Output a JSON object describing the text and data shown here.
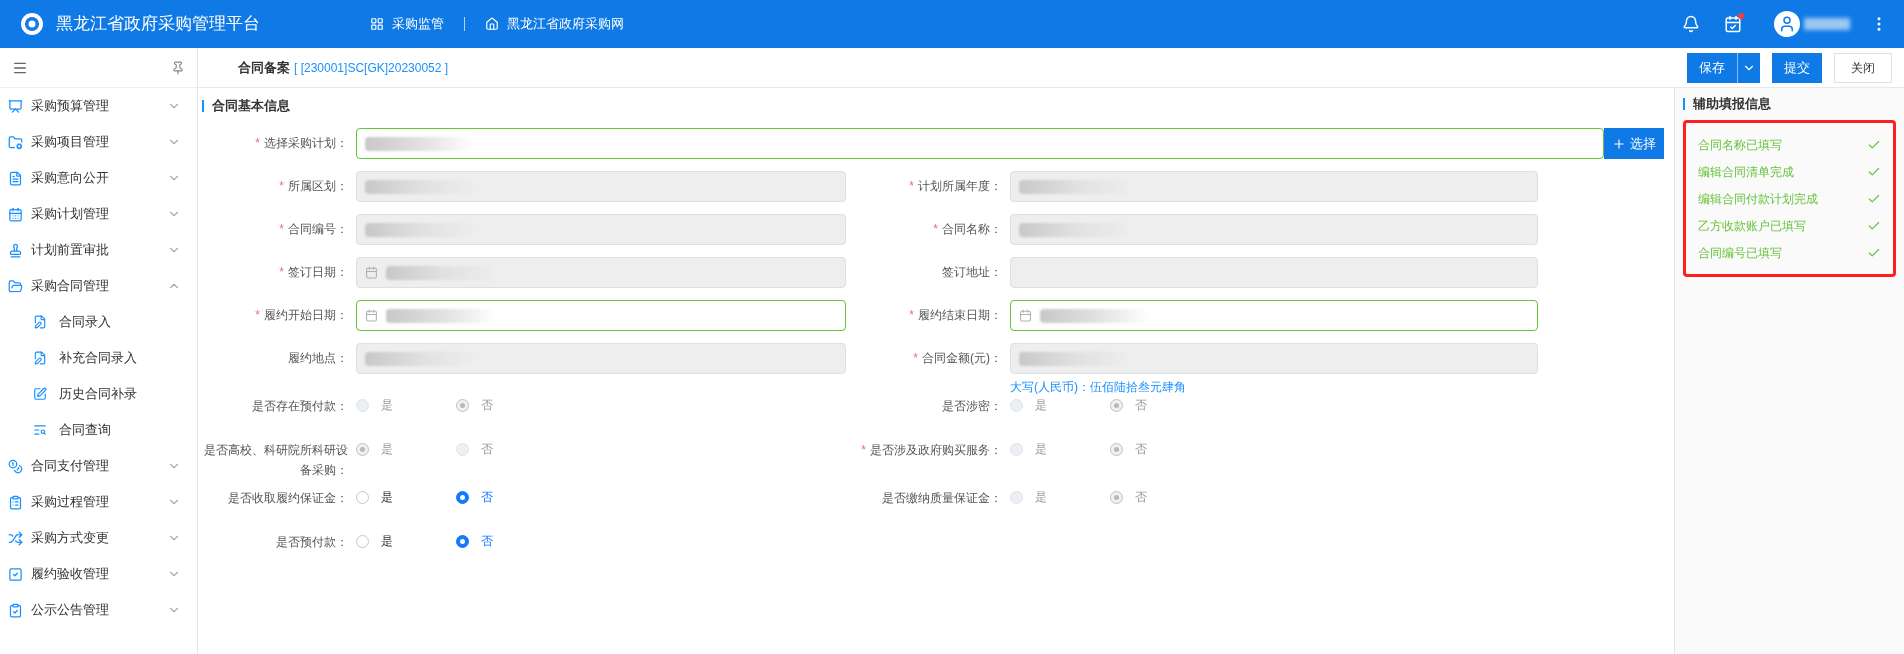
{
  "header": {
    "title": "黑龙江省政府采购管理平台",
    "nav": [
      "采购监管",
      "黑龙江省政府采购网"
    ],
    "notice_unread": true
  },
  "sidebar": {
    "items": [
      {
        "label": "采购预算管理",
        "expanded": false
      },
      {
        "label": "采购项目管理",
        "expanded": false
      },
      {
        "label": "采购意向公开",
        "expanded": false
      },
      {
        "label": "采购计划管理",
        "expanded": false
      },
      {
        "label": "计划前置审批",
        "expanded": false
      },
      {
        "label": "采购合同管理",
        "expanded": true,
        "children": [
          {
            "label": "合同录入"
          },
          {
            "label": "补充合同录入"
          },
          {
            "label": "历史合同补录"
          },
          {
            "label": "合同查询"
          }
        ]
      },
      {
        "label": "合同支付管理",
        "expanded": false
      },
      {
        "label": "采购过程管理",
        "expanded": false
      },
      {
        "label": "采购方式变更",
        "expanded": false
      },
      {
        "label": "履约验收管理",
        "expanded": false
      },
      {
        "label": "公示公告管理",
        "expanded": false
      }
    ]
  },
  "tab": {
    "title": "合同备案",
    "code": "[ [230001]SC[GK]20230052 ]"
  },
  "actions": [
    {
      "label": "保存",
      "kind": "split"
    },
    {
      "label": "提交",
      "kind": "primary"
    },
    {
      "label": "关闭",
      "kind": "plain"
    }
  ],
  "section": {
    "title": "合同基本信息"
  },
  "form": {
    "rows": [
      [
        {
          "kind": "select",
          "label": "选择采购计划：",
          "required_mark": "*",
          "disabled": false,
          "valid": true,
          "redacted": true,
          "button": "选择"
        }
      ],
      [
        {
          "kind": "text",
          "label": "所属区划：",
          "required_mark": "*",
          "disabled": true,
          "valid": false,
          "redacted": true
        },
        {
          "kind": "text",
          "label": "计划所属年度：",
          "required_mark": "*",
          "disabled": true,
          "valid": false,
          "redacted": true
        }
      ],
      [
        {
          "kind": "text",
          "label": "合同编号：",
          "required_mark": "*",
          "disabled": true,
          "valid": false,
          "redacted": true
        },
        {
          "kind": "text",
          "label": "合同名称：",
          "required_mark": "*",
          "disabled": true,
          "valid": false,
          "redacted": true
        }
      ],
      [
        {
          "kind": "date",
          "label": "签订日期：",
          "required_mark": "*",
          "disabled": true,
          "valid": false,
          "redacted": true
        },
        {
          "kind": "text",
          "label": "签订地址：",
          "disabled": true,
          "valid": false
        }
      ],
      [
        {
          "kind": "date",
          "label": "履约开始日期：",
          "required_mark": "*",
          "disabled": false,
          "valid": true,
          "redacted": true
        },
        {
          "kind": "date",
          "label": "履约结束日期：",
          "required_mark": "*",
          "disabled": false,
          "valid": true,
          "redacted": true
        }
      ],
      [
        {
          "kind": "text",
          "label": "履约地点：",
          "disabled": true,
          "valid": false,
          "redacted": true
        },
        {
          "kind": "text",
          "label": "合同金额(元)：",
          "required_mark": "*",
          "disabled": true,
          "valid": false,
          "redacted": true,
          "note": "大写(人民币)：伍佰陆拾叁元肆角"
        }
      ],
      [
        {
          "kind": "radio",
          "label": "是否存在预付款：",
          "disabled": true,
          "options": [
            {
              "label": "是",
              "selected": false
            },
            {
              "label": "否",
              "selected": true
            }
          ]
        },
        {
          "kind": "radio",
          "label": "是否涉密：",
          "disabled": true,
          "options": [
            {
              "label": "是",
              "selected": false
            },
            {
              "label": "否",
              "selected": true
            }
          ]
        }
      ],
      [
        {
          "kind": "radio",
          "label": "是否高校、科研院所科研设备采购：",
          "disabled": true,
          "options": [
            {
              "label": "是",
              "selected": true
            },
            {
              "label": "否",
              "selected": false
            }
          ]
        },
        {
          "kind": "radio",
          "label": "是否涉及政府购买服务：",
          "required_mark": "*",
          "disabled": true,
          "options": [
            {
              "label": "是",
              "selected": false
            },
            {
              "label": "否",
              "selected": true
            }
          ]
        }
      ],
      [
        {
          "kind": "radio",
          "label": "是否收取履约保证金：",
          "disabled": false,
          "options": [
            {
              "label": "是",
              "selected": false
            },
            {
              "label": "否",
              "selected": true
            }
          ]
        },
        {
          "kind": "radio",
          "label": "是否缴纳质量保证金：",
          "disabled": true,
          "options": [
            {
              "label": "是",
              "selected": false
            },
            {
              "label": "否",
              "selected": true
            }
          ]
        }
      ],
      [
        {
          "kind": "radio",
          "label": "是否预付款：",
          "disabled": false,
          "options": [
            {
              "label": "是",
              "selected": false
            },
            {
              "label": "否",
              "selected": true
            }
          ]
        }
      ]
    ]
  },
  "assist": {
    "title": "辅助填报信息",
    "highlighted": true,
    "items": [
      {
        "label": "合同名称已填写",
        "checked": true
      },
      {
        "label": "编辑合同清单完成",
        "checked": true
      },
      {
        "label": "编辑合同付款计划完成",
        "checked": true
      },
      {
        "label": "乙方收款账户已填写",
        "checked": true
      },
      {
        "label": "合同编号已填写",
        "checked": true
      }
    ]
  }
}
